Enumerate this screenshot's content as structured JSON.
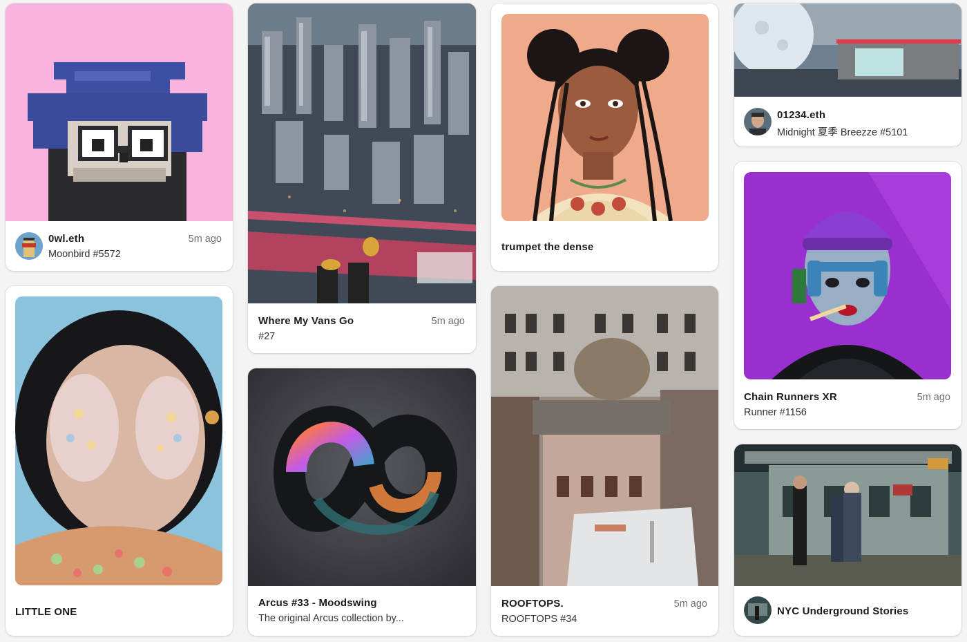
{
  "feed": {
    "cards": [
      {
        "id": "moonbird",
        "title": "0wl.eth",
        "subtitle": "Moonbird #5572",
        "time": "5m ago",
        "image": "pixel-owl-art",
        "avatar": "punk-avatar"
      },
      {
        "id": "vans",
        "title": "Where My Vans Go",
        "subtitle": "#27",
        "time": "5m ago",
        "image": "city-aerial-photo"
      },
      {
        "id": "trumpet",
        "title": "trumpet the dense",
        "image": "illustrated-girl-portrait"
      },
      {
        "id": "midnight",
        "title": "01234.eth",
        "subtitle": "Midnight 夏季 Breezze #5101",
        "image": "neon-diner-moon-art",
        "avatar": "man-avatar"
      },
      {
        "id": "littleone",
        "title": "LITTLE ONE",
        "image": "surreal-girl-painting"
      },
      {
        "id": "arcus",
        "title": "Arcus #33 - Moodswing",
        "subtitle": "The original Arcus collection by...",
        "image": "abstract-swirl-render"
      },
      {
        "id": "rooftops",
        "title": "ROOFTOPS.",
        "subtitle": "ROOFTOPS #34",
        "time": "5m ago",
        "image": "rooftop-photo"
      },
      {
        "id": "chainrunners",
        "title": "Chain Runners XR",
        "subtitle": "Runner #1156",
        "time": "5m ago",
        "image": "cyborg-portrait-art"
      },
      {
        "id": "nyc",
        "title": "NYC Underground Stories",
        "image": "subway-photo",
        "avatar": "subway-avatar"
      }
    ]
  },
  "colors": {
    "pink_bg": "#f9b3df",
    "peach_bg": "#eeaa8a",
    "purple_bg": "#9a2fcf",
    "sky_bg": "#8cc3dc"
  }
}
